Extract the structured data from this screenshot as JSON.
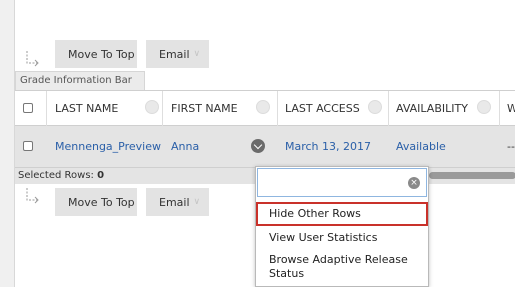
{
  "toolbar_top": {
    "move_to_top": "Move To Top",
    "email": "Email"
  },
  "toolbar_bottom": {
    "move_to_top": "Move To Top",
    "email": "Email"
  },
  "grade_info_bar": "Grade Information Bar",
  "columns": [
    {
      "label": "LAST NAME"
    },
    {
      "label": "FIRST NAME"
    },
    {
      "label": "LAST ACCESS"
    },
    {
      "label": "AVAILABILITY"
    },
    {
      "label": "W"
    }
  ],
  "row": {
    "last_name": "Mennenga_Preview",
    "first_name": "Anna",
    "last_access": "March 13, 2017",
    "availability": "Available",
    "extra": "--"
  },
  "selected_rows": {
    "label": "Selected Rows:",
    "count": "0"
  },
  "context_menu": {
    "search_value": "",
    "items": [
      {
        "label": "Hide Other Rows",
        "highlighted": true
      },
      {
        "label": "View User Statistics"
      },
      {
        "label": "Browse Adaptive Release Status"
      }
    ]
  },
  "icons": {
    "turn_arrow": "turn-arrow-icon",
    "chevron": "chevron-down-icon",
    "clear": "clear-icon"
  },
  "colors": {
    "link": "#2a5fa8",
    "highlight": "#c9312a"
  }
}
